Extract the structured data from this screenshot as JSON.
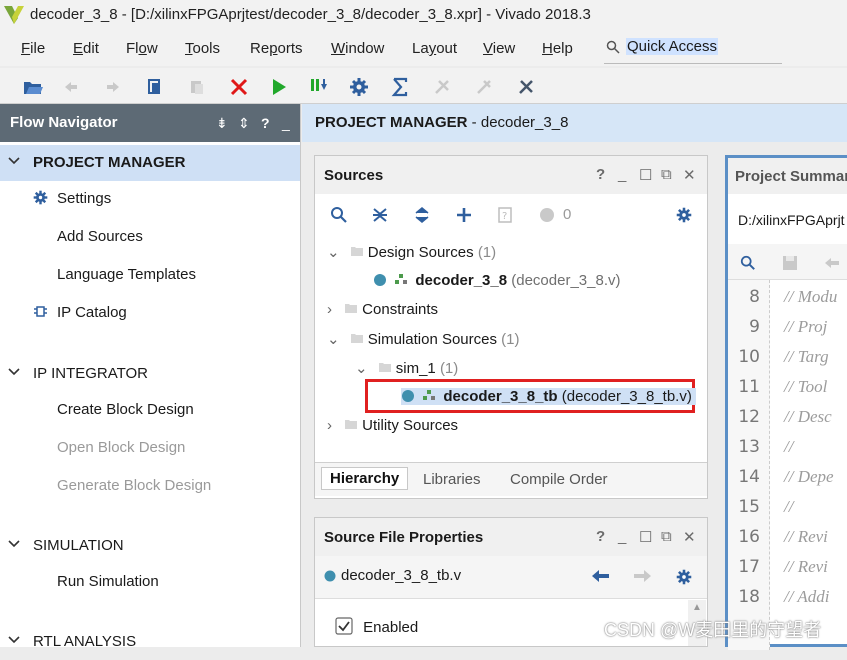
{
  "window": {
    "title": "decoder_3_8 - [D:/xilinxFPGAprjtest/decoder_3_8/decoder_3_8.xpr] - Vivado 2018.3"
  },
  "menu": {
    "items": [
      {
        "label": "File",
        "u": "F",
        "rest": "ile"
      },
      {
        "label": "Edit",
        "u": "E",
        "rest": "dit"
      },
      {
        "label": "Flow",
        "u": "",
        "rest": "Fl",
        "u2": "o",
        "rest2": "w"
      },
      {
        "label": "Tools",
        "u": "T",
        "rest": "ools"
      },
      {
        "label": "Reports",
        "u": "",
        "rest": "Re",
        "u2": "p",
        "rest2": "orts"
      },
      {
        "label": "Window",
        "u": "W",
        "rest": "indow"
      },
      {
        "label": "Layout",
        "u": "",
        "rest": "La",
        "u2": "y",
        "rest2": "out"
      },
      {
        "label": "View",
        "u": "V",
        "rest": "iew"
      },
      {
        "label": "Help",
        "u": "H",
        "rest": "elp"
      }
    ],
    "quick_access": "Quick Access"
  },
  "flow_navigator": {
    "title": "Flow Navigator",
    "project_manager": "PROJECT MANAGER",
    "settings": "Settings",
    "add_sources": "Add Sources",
    "language_templates": "Language Templates",
    "ip_catalog": "IP Catalog",
    "ip_integrator": "IP INTEGRATOR",
    "create_block_design": "Create Block Design",
    "open_block_design": "Open Block Design",
    "generate_block_design": "Generate Block Design",
    "simulation": "SIMULATION",
    "run_simulation": "Run Simulation",
    "rtl_analysis": "RTL ANALYSIS"
  },
  "main": {
    "header_bold": "PROJECT MANAGER",
    "header_rest": " - decoder_3_8"
  },
  "sources": {
    "title": "Sources",
    "count_badge": "0",
    "design_sources": "Design Sources",
    "design_sources_count": "(1)",
    "decoder_name": "decoder_3_8",
    "decoder_file": "(decoder_3_8.v)",
    "constraints": "Constraints",
    "simulation_sources": "Simulation Sources",
    "simulation_sources_count": "(1)",
    "sim_1": "sim_1",
    "sim_1_count": "(1)",
    "tb_name": "decoder_3_8_tb",
    "tb_file": "(decoder_3_8_tb.v)",
    "utility_sources": "Utility Sources",
    "tabs": {
      "hierarchy": "Hierarchy",
      "libraries": "Libraries",
      "compile_order": "Compile Order"
    }
  },
  "file_props": {
    "title": "Source File Properties",
    "file": "decoder_3_8_tb.v",
    "enabled_label": "Enabled",
    "enabled": true
  },
  "editor": {
    "title": "Project Summar",
    "path": "D:/xilinxFPGAprjt",
    "lines": [
      {
        "n": "8",
        "text": "// Modu"
      },
      {
        "n": "9",
        "text": "// Proj"
      },
      {
        "n": "10",
        "text": "// Targ"
      },
      {
        "n": "11",
        "text": "// Tool"
      },
      {
        "n": "12",
        "text": "// Desc"
      },
      {
        "n": "13",
        "text": "//"
      },
      {
        "n": "14",
        "text": "// Depe"
      },
      {
        "n": "15",
        "text": "//"
      },
      {
        "n": "16",
        "text": "// Revi"
      },
      {
        "n": "17",
        "text": "// Revi"
      },
      {
        "n": "18",
        "text": "// Addi"
      }
    ]
  },
  "watermark": "CSDN @W麦田里的守望者",
  "colors": {
    "accent": "#5d6a75",
    "selection": "#cfe0f5",
    "highlight_box": "#e02020"
  }
}
